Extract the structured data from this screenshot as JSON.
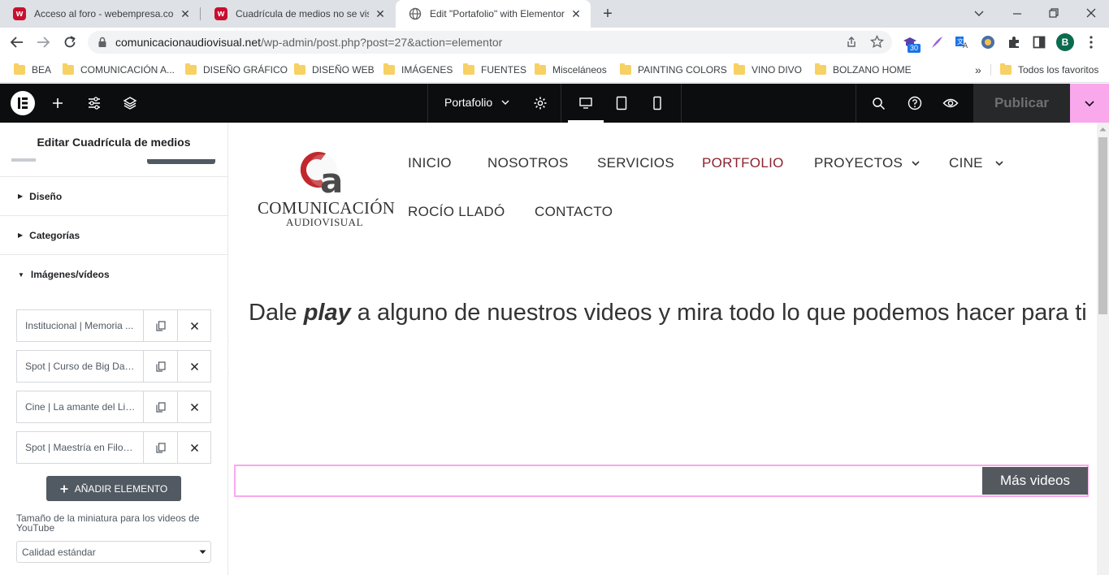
{
  "browser": {
    "tabs": [
      {
        "title": "Acceso al foro - webempresa.co",
        "favicon": "w"
      },
      {
        "title": "Cuadrícula de medios no se visu",
        "favicon": "w"
      },
      {
        "title": "Edit \"Portafolio\" with Elementor",
        "favicon": "globe"
      }
    ],
    "url": {
      "host": "comunicacionaudiovisual.net",
      "path": "/wp-admin/post.php?post=27&action=elementor"
    },
    "extension_badge": "30",
    "profile_initial": "B",
    "bookmarks": [
      "BEA",
      "COMUNICACIÓN A...",
      "DISEÑO GRÁFICO",
      "DISEÑO WEB",
      "IMÁGENES",
      "FUENTES",
      "Misceláneos",
      "PAINTING COLORS",
      "VINO DIVO",
      "BOLZANO HOME"
    ],
    "bookmarks_overflow": "»",
    "all_bookmarks": "Todos los favoritos"
  },
  "editor": {
    "page_name": "Portafolio",
    "publish_label": "Publicar",
    "panel_title": "Editar Cuadrícula de medios",
    "sections": {
      "diseno": "Diseño",
      "categorias": "Categorías",
      "imagenes": "Imágenes/vídeos"
    },
    "items": [
      "Institucional | Memoria ...",
      "Spot | Curso de Big Dat...",
      "Cine | La amante del Lib...",
      "Spot | Maestría en Filos..."
    ],
    "add_label": "AÑADIR ELEMENTO",
    "thumb_size_label": "Tamaño de la miniatura para los videos de YouTube",
    "thumb_size_value": "Calidad estándar"
  },
  "site": {
    "logo_line1": "COMUNICACIÓN",
    "logo_line2": "AUDIOVISUAL",
    "logo_mark": "a",
    "nav": [
      "INICIO",
      "NOSOTROS",
      "SERVICIOS",
      "PORTFOLIO",
      "PROYECTOS",
      "CINE",
      "ROCÍO LLADÓ",
      "CONTACTO"
    ],
    "headline_pre": "Dale ",
    "headline_em": "play",
    "headline_post": " a alguno de nuestros videos y mira todo lo que podemos hacer para ti",
    "more_button": "Más videos"
  },
  "colors": {
    "accent_pink": "#f9a8ec",
    "active_nav": "#8b2330",
    "logo_red": "#c1272d",
    "button_dark": "#54595f"
  }
}
